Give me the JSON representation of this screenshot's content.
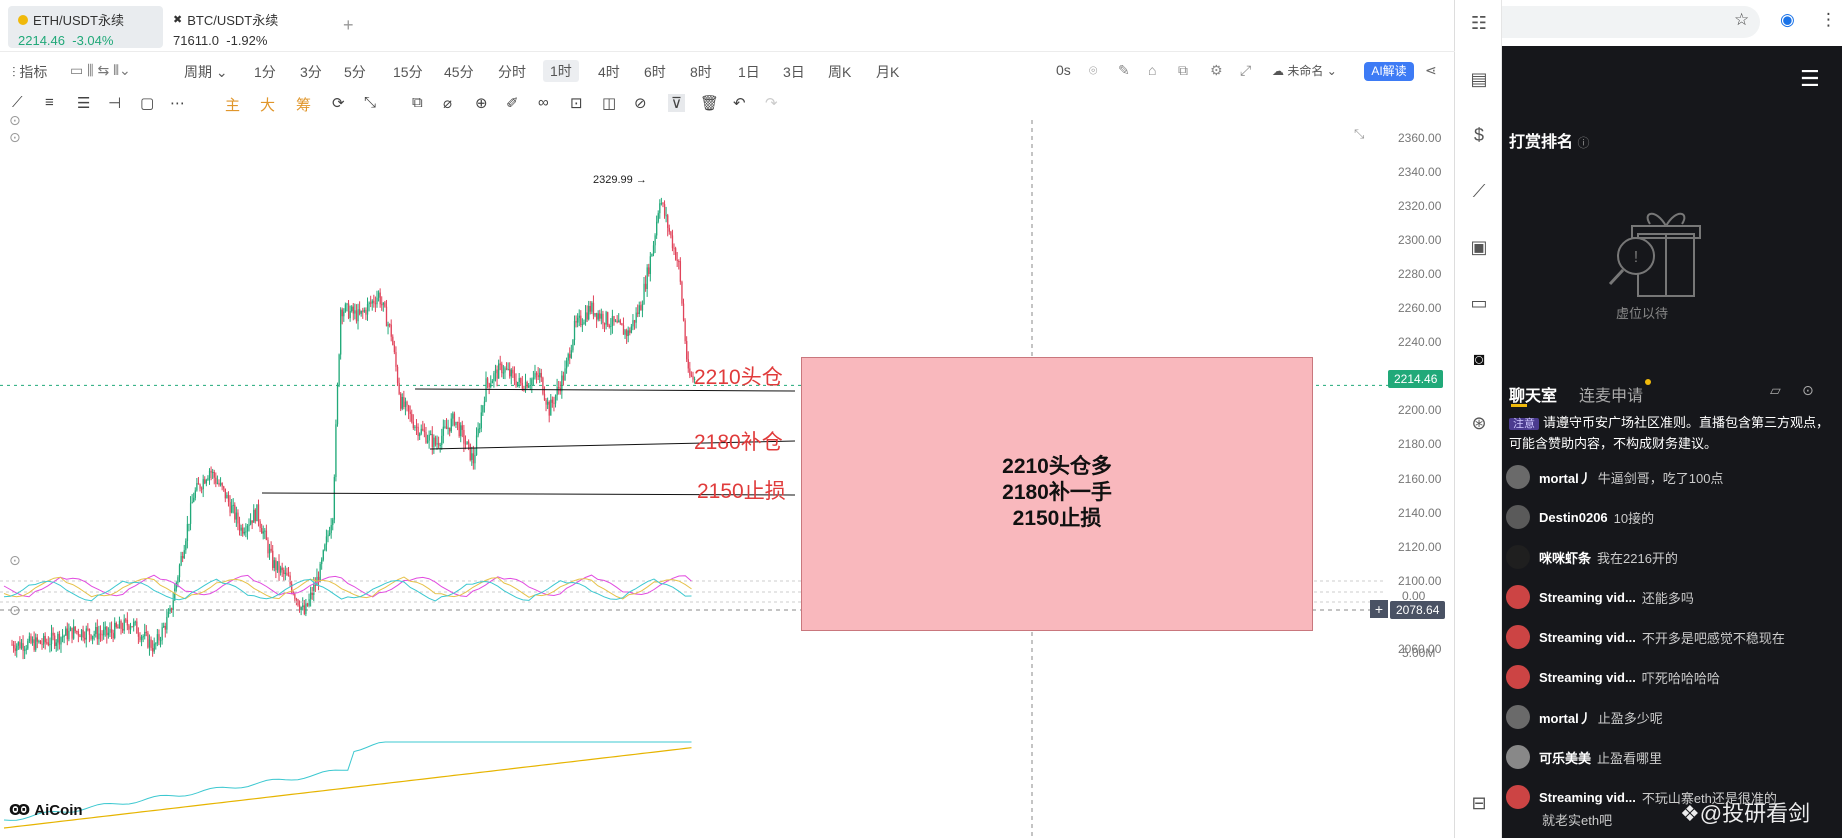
{
  "tabs": [
    {
      "name": "ETH/USDT永续",
      "price": "2214.46",
      "change": "-3.04%",
      "active": true
    },
    {
      "name": "BTC/USDT永续",
      "price": "71611.0",
      "change": "-1.92%",
      "active": false
    }
  ],
  "toolbar": {
    "indicators": "指标",
    "period": "周期",
    "intervals": [
      "1分",
      "3分",
      "5分",
      "15分",
      "45分",
      "分时",
      "1时",
      "4时",
      "6时",
      "8时",
      "1日",
      "3日",
      "周K",
      "月K"
    ],
    "selected_interval": "1时",
    "countdown": "0s",
    "layout_name": "未命名",
    "ai_label": "AI解读"
  },
  "drawing_toolbar": {
    "labels_cn": [
      "主",
      "大",
      "筹"
    ]
  },
  "chart": {
    "symbol": "ETH/USDT永续",
    "price_ticks": [
      "2360.00",
      "2340.00",
      "2320.00",
      "2300.00",
      "2280.00",
      "2260.00",
      "2240.00",
      "2220.00",
      "2200.00",
      "2180.00",
      "2160.00",
      "2140.00",
      "2120.00",
      "2100.00",
      "2080.00",
      "2060.00"
    ],
    "indicator_tick": "0.00",
    "volume_tick": "5.00M",
    "current_price": "2214.46",
    "crosshair_price": "2078.64",
    "high_label": "2329.99",
    "brand": "AiCoin",
    "colors": {
      "up": "#21a979",
      "down": "#e0435a",
      "current": "#21a979"
    },
    "levels": [
      {
        "price": 2210,
        "label": "2210头仓"
      },
      {
        "price": 2180,
        "label": "2180补仓"
      },
      {
        "price": 2150,
        "label": "2150止损"
      }
    ],
    "annotation": [
      "2210头仓多",
      "2180补一手",
      "2150止损"
    ]
  },
  "live": {
    "rank_title": "打赏排名",
    "empty_text": "虚位以待",
    "tab_chat": "聊天室",
    "tab_mic": "连麦申请",
    "notice_tag": "注意",
    "notice": "请遵守币安广场社区准则。直播包含第三方观点，可能含赞助内容，不构成财务建议。",
    "messages": [
      {
        "nick": "mortal丿",
        "text": "牛逼剑哥，吃了100点"
      },
      {
        "nick": "Destin0206",
        "text": "10接的"
      },
      {
        "nick": "咪咪虾条",
        "text": "我在2216开的"
      },
      {
        "nick": "Streaming vid...",
        "text": "还能多吗"
      },
      {
        "nick": "Streaming vid...",
        "text": "不开多是吧感觉不稳现在"
      },
      {
        "nick": "Streaming vid...",
        "text": "吓死哈哈哈哈"
      },
      {
        "nick": "mortal丿",
        "text": "止盈多少呢"
      },
      {
        "nick": "可乐美美",
        "text": "止盈看哪里"
      },
      {
        "nick": "Streaming vid...",
        "text": "不玩山寨eth还是很准的"
      }
    ],
    "last_line": "就老实eth吧",
    "watermark": "@投研看剑"
  }
}
